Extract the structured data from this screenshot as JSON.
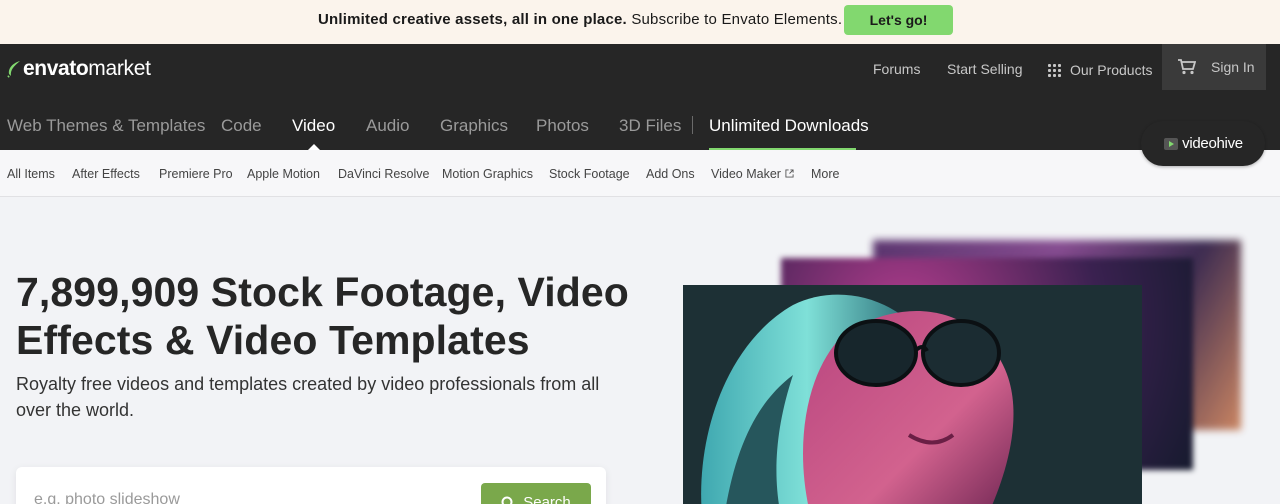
{
  "promo": {
    "bold_text": "Unlimited creative assets, all in one place.",
    "text": "Subscribe to Envato Elements.",
    "button": "Let's go!"
  },
  "header": {
    "logo_brand": "envato",
    "logo_market": "market",
    "links": {
      "forums": "Forums",
      "start_selling": "Start Selling",
      "our_products": "Our Products",
      "sign_in": "Sign In"
    }
  },
  "nav": {
    "items": [
      "Web Themes & Templates",
      "Code",
      "Video",
      "Audio",
      "Graphics",
      "Photos",
      "3D Files",
      "Unlimited Downloads"
    ],
    "active": "Video"
  },
  "badge": {
    "label": "videohive"
  },
  "subnav": {
    "items": [
      "All Items",
      "After Effects",
      "Premiere Pro",
      "Apple Motion",
      "DaVinci Resolve",
      "Motion Graphics",
      "Stock Footage",
      "Add Ons",
      "Video Maker",
      "More"
    ]
  },
  "hero": {
    "title": "7,899,909 Stock Footage, Video Effects & Video Templates",
    "subtitle": "Royalty free videos and templates created by video professionals from all over the world."
  },
  "search": {
    "placeholder": "e.g. photo slideshow",
    "button": "Search"
  },
  "colors": {
    "accent_green": "#82d86f",
    "search_green": "#7aa84b",
    "header_dark": "#262626"
  }
}
